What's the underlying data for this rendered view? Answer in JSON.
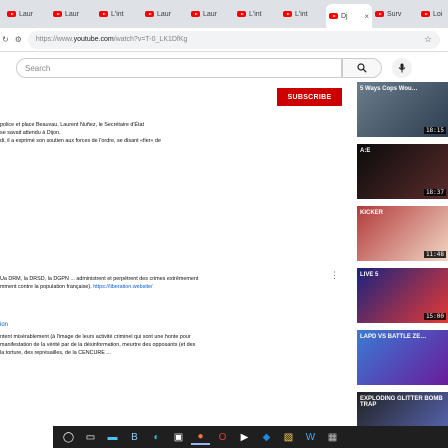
{
  "browser": {
    "tabs": [
      {
        "label": "Laur",
        "active": false
      },
      {
        "label": "Laur",
        "active": false
      },
      {
        "label": "L'int",
        "active": false
      },
      {
        "label": "Laur",
        "active": false
      },
      {
        "label": "Laur",
        "active": false
      },
      {
        "label": "L'int",
        "active": false
      },
      {
        "label": "L'int",
        "active": false
      },
      {
        "label": "Dj",
        "active": true
      },
      {
        "label": "Surv",
        "active": false
      },
      {
        "label": "Loi",
        "active": false
      }
    ],
    "tab_close": "×",
    "url_scheme": "https://www.",
    "url_host": "youtube.com",
    "url_path": "/watch?v=T-0_LK1DfKg"
  },
  "youtube": {
    "search_placeholder": "Search",
    "subscribe_label": "SUBSCRIBE",
    "description_top": [
      "police et place Beauvau, Laurent Nuñez, le Secrétaire d'État",
      "se savait attendu à Dijon.",
      "di, il a exprimé son soutien aux forces de l'ordre, se disant «fier» de"
    ],
    "description_mid_line1": "Ua  DRM, la DRSD, la DGPN ... administrent et perpètrent des crimes extrêmement",
    "description_mid_line2_text": "mment contre la population française). ",
    "description_mid_line2_link": "https://liberation.website/",
    "section_link": "ion",
    "description_bottom": [
      "ntent misérablement (à l'image de leurs activité criminel qui sont une honte pour",
      "manifestation de la vérité par de la désinformation, meurtre des opposants (et des",
      "la torture, des représailles, de la CENCURE ..."
    ],
    "more_icon": "⋮"
  },
  "related": [
    {
      "overlay": "5 Ways Cops Wou…",
      "duration": "18:15",
      "colors": [
        "#6b7d8c",
        "#2c3e50"
      ]
    },
    {
      "overlay": "A:E",
      "duration": "18:37",
      "colors": [
        "#0b0b0b",
        "#5a2b2b"
      ]
    },
    {
      "overlay": "KICKER",
      "duration": "11:48",
      "colors": [
        "#b33a3a",
        "#f0d7c6"
      ]
    },
    {
      "overlay": "LIVE 5",
      "duration": "15:00",
      "colors": [
        "#1a237e",
        "#e53935"
      ]
    },
    {
      "overlay": "LAPD VS BATTLE ZE…",
      "duration": "",
      "colors": [
        "#3a7bd5",
        "#6a1b9a"
      ]
    },
    {
      "overlay": "EXPLODING GLITTER BOMB TRAP",
      "duration": "",
      "colors": [
        "#222",
        "#5c6bc0"
      ]
    }
  ],
  "taskbar": {
    "items": [
      {
        "name": "start-icon",
        "glyph": "◯",
        "color": "#ffffff"
      },
      {
        "name": "task-view-icon",
        "glyph": "▭",
        "color": "#ffffff"
      },
      {
        "name": "file-explorer-icon",
        "glyph": "▬",
        "color": "#4fc3f7"
      },
      {
        "name": "app-icon",
        "glyph": "B",
        "color": "#90caf9"
      },
      {
        "name": "edge-icon",
        "glyph": "◐",
        "color": "#26c6da"
      },
      {
        "name": "store-icon",
        "glyph": "▣",
        "color": "#ffffff"
      },
      {
        "name": "firefox-icon",
        "glyph": "●",
        "color": "#ff7043"
      },
      {
        "name": "opera-icon",
        "glyph": "O",
        "color": "#e53935"
      },
      {
        "name": "play-icon",
        "glyph": "▶",
        "color": "#ffffff"
      },
      {
        "name": "dropbox-icon",
        "glyph": "◆",
        "color": "#1e88e5"
      },
      {
        "name": "photos-icon",
        "glyph": "▧",
        "color": "#ffd54f"
      },
      {
        "name": "word-icon",
        "glyph": "W",
        "color": "#42a5f5"
      },
      {
        "name": "misc-icon",
        "glyph": "▦",
        "color": "#bdbdbd"
      }
    ]
  }
}
